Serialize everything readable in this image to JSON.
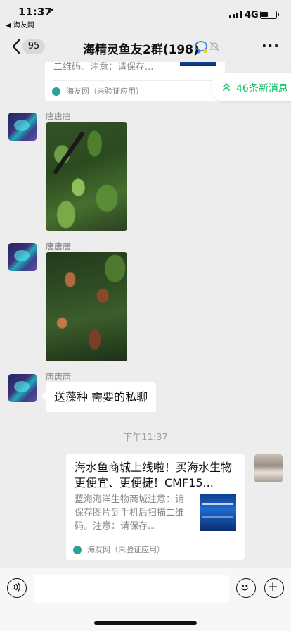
{
  "status": {
    "time": "11:37",
    "back_app": "◀ 海友网",
    "network": "4G",
    "battery_level": 0.45
  },
  "nav": {
    "back_count": "95",
    "title": "海精灵鱼友2群(198)"
  },
  "top_card": {
    "desc_tail": "二维码。注意：请保存...",
    "footer": "海友网（未验证应用）"
  },
  "new_messages": "46条新消息",
  "messages": [
    {
      "sender": "唐唐唐"
    },
    {
      "sender": "唐唐唐"
    },
    {
      "sender": "唐唐唐",
      "text": "送藻种  需要的私聊"
    }
  ],
  "timestamp": "下午11:37",
  "share_card": {
    "title": "海水鱼商城上线啦！买海水生物更便宜、更便捷！CMF15...",
    "desc": "蓝海海洋生物商城注意：请保存图片到手机后扫描二维码。注意：请保存...",
    "footer": "海友网（未验证应用）"
  },
  "icons": {
    "voice": "voice-icon",
    "emoji": "emoji-icon",
    "plus": "plus-icon",
    "back": "chevron-left-icon"
  },
  "colors": {
    "accent_green": "#07c160",
    "background": "#ededed"
  }
}
